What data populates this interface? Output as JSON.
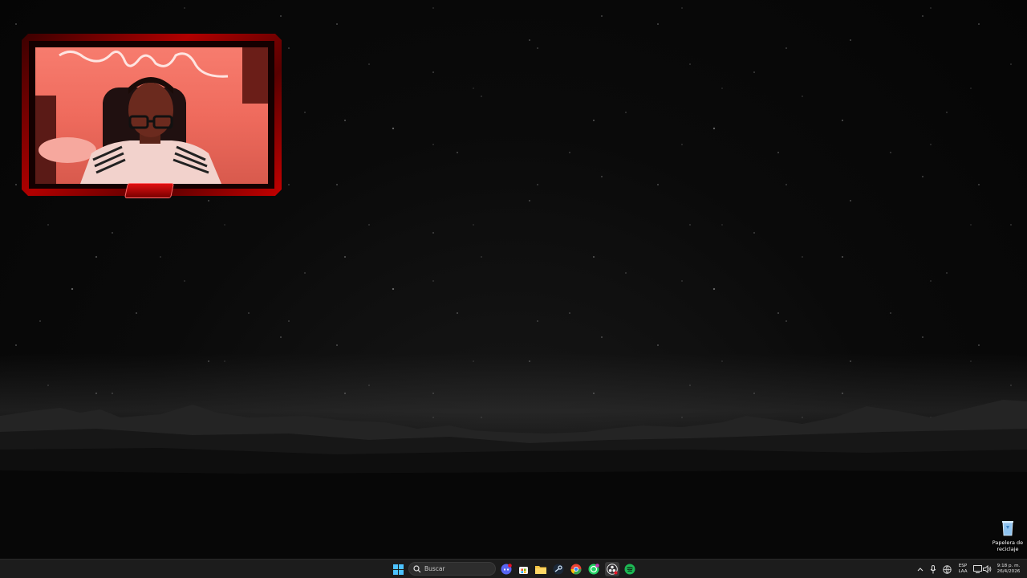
{
  "desktop": {
    "recycle_bin_label_line1": "Papelera de",
    "recycle_bin_label_line2": "reciclaje"
  },
  "webcam_overlay": {
    "badge_text": "",
    "frame_color": "#c40000"
  },
  "taskbar": {
    "search_placeholder": "Buscar",
    "pinned_icons": [
      "windows-start-icon",
      "search-icon",
      "discord-icon",
      "microsoft-store-icon",
      "file-explorer-icon",
      "steam-icon",
      "chrome-icon",
      "whatsapp-icon",
      "obs-icon",
      "spotify-icon"
    ],
    "tray": {
      "language_line1": "ESP",
      "language_line2": "LAA",
      "time": "9:18 p. m.",
      "date": "26/4/2026",
      "icons": [
        "chevron-up-icon",
        "microphone-icon",
        "network-icon",
        "speaker-icon",
        "notification-icon"
      ]
    },
    "accent_colors": {
      "windows_blue": "#4cc2ff",
      "discord": "#5865f2",
      "whatsapp": "#25d366",
      "spotify": "#1db954",
      "chrome_red": "#ea4335",
      "chrome_yellow": "#fbbc05",
      "chrome_green": "#34a853"
    }
  }
}
